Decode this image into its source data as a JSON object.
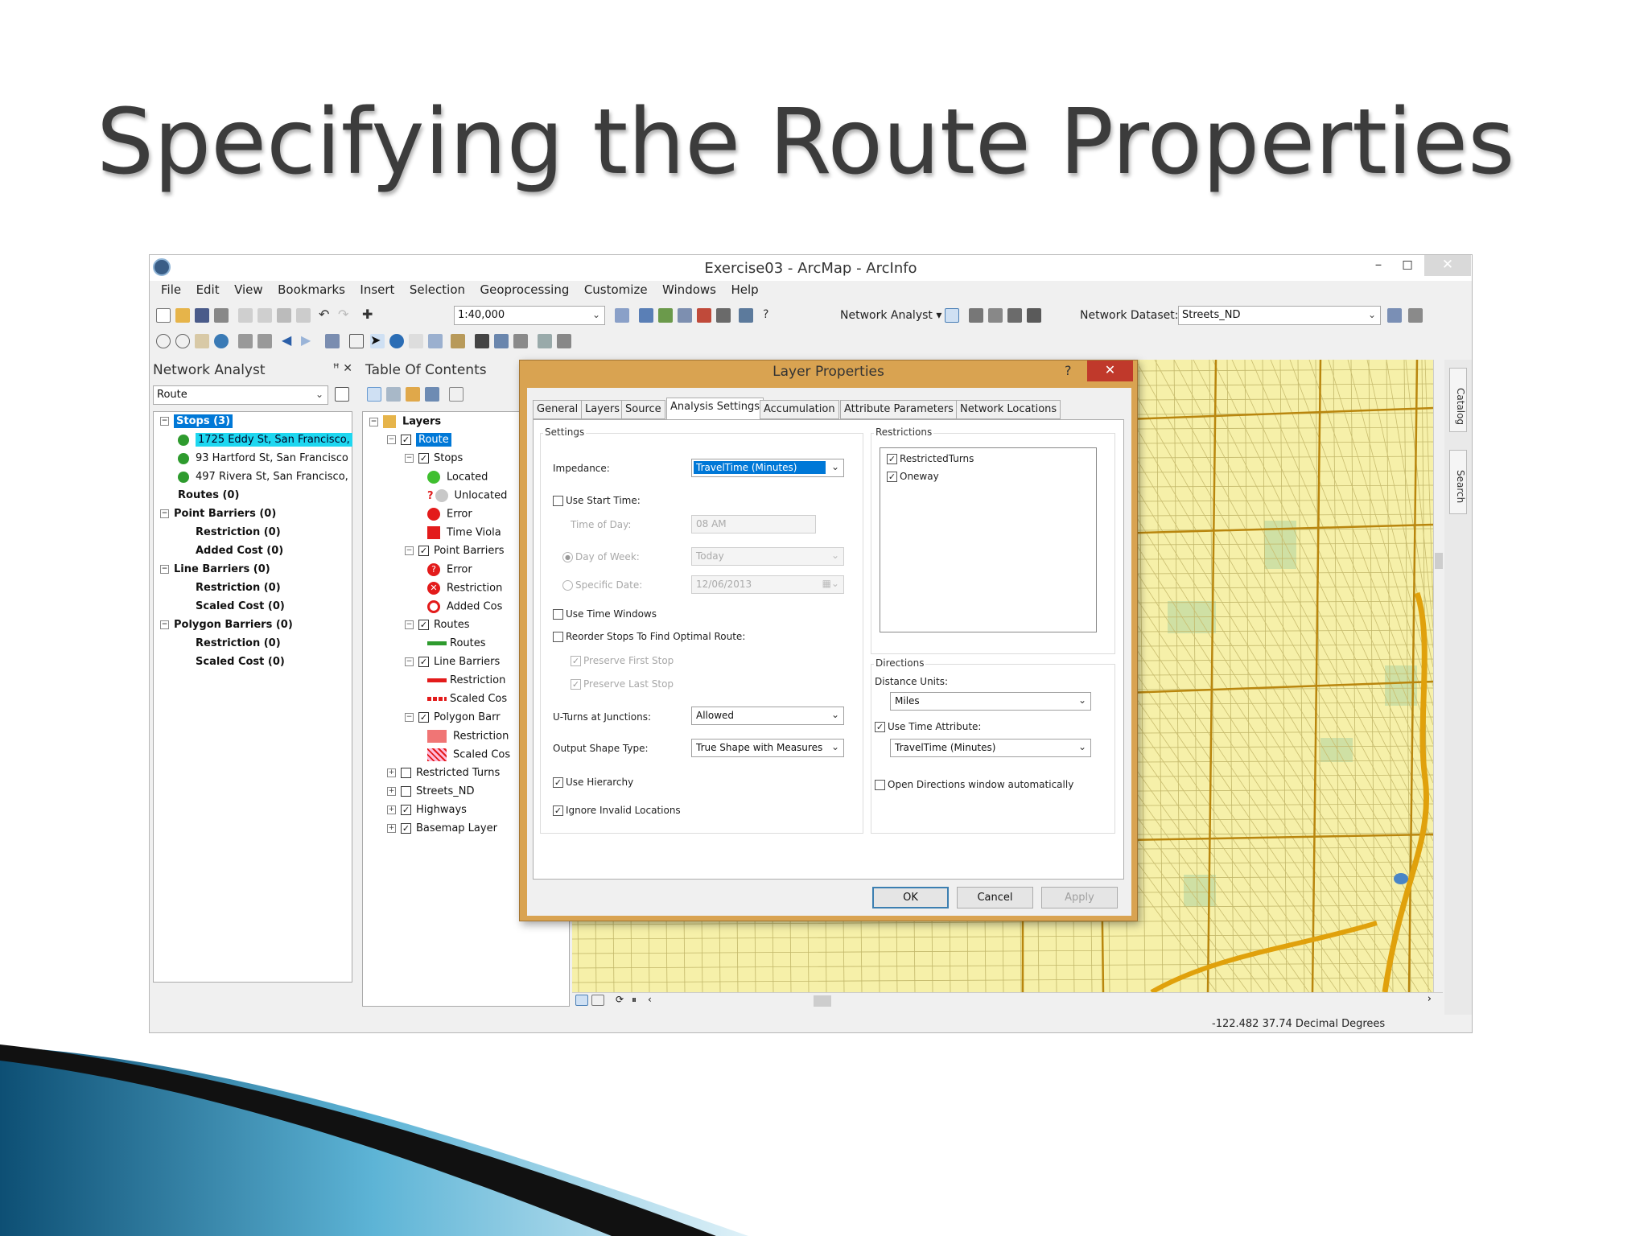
{
  "slide": {
    "title": "Specifying the Route Properties"
  },
  "window": {
    "title": "Exercise03 - ArcMap - ArcInfo",
    "minimize": "–",
    "restore": "◻",
    "close": "✕"
  },
  "menu": [
    "File",
    "Edit",
    "View",
    "Bookmarks",
    "Insert",
    "Selection",
    "Geoprocessing",
    "Customize",
    "Windows",
    "Help"
  ],
  "toolbar": {
    "scale": "1:40,000",
    "network_analyst": "Network Analyst ▾",
    "network_dataset_label": "Network Dataset:",
    "network_dataset_value": "Streets_ND"
  },
  "na_window": {
    "title": "Network Analyst",
    "pin": "ꟸ ✕",
    "analysis_layer": "Route",
    "tree": [
      {
        "label": "Stops (3)",
        "indent": 0,
        "expander": "−",
        "selected": true
      },
      {
        "label": "1725 Eddy St, San Francisco,",
        "indent": 1,
        "icon": "stop-1",
        "selected": true
      },
      {
        "label": "93 Hartford St, San Francisco",
        "indent": 1,
        "icon": "stop-2"
      },
      {
        "label": "497 Rivera St, San Francisco,",
        "indent": 1,
        "icon": "stop-3"
      },
      {
        "label": "Routes (0)",
        "indent": 1
      },
      {
        "label": "Point Barriers (0)",
        "indent": 0,
        "expander": "−"
      },
      {
        "label": "Restriction (0)",
        "indent": 2
      },
      {
        "label": "Added Cost (0)",
        "indent": 2
      },
      {
        "label": "Line Barriers (0)",
        "indent": 0,
        "expander": "−"
      },
      {
        "label": "Restriction (0)",
        "indent": 2
      },
      {
        "label": "Scaled Cost (0)",
        "indent": 2
      },
      {
        "label": "Polygon Barriers (0)",
        "indent": 0,
        "expander": "−"
      },
      {
        "label": "Restriction (0)",
        "indent": 2
      },
      {
        "label": "Scaled Cost (0)",
        "indent": 2
      }
    ]
  },
  "toc": {
    "title": "Table Of Contents",
    "rows": [
      {
        "label": "Layers",
        "level": 0,
        "expander": "−",
        "kind": "folder"
      },
      {
        "label": "Route",
        "level": 1,
        "expander": "−",
        "checked": true,
        "selected": true
      },
      {
        "label": "Stops",
        "level": 2,
        "expander": "−",
        "checked": true
      },
      {
        "label": "Located",
        "level": 3,
        "symbol": "green-dot"
      },
      {
        "label": "Unlocated",
        "level": 3,
        "symbol": "question-dot",
        "symbol_text": "?"
      },
      {
        "label": "Error",
        "level": 3,
        "symbol": "red-dot"
      },
      {
        "label": "Time Viola",
        "level": 3,
        "symbol": "red-square"
      },
      {
        "label": "Point Barriers",
        "level": 2,
        "expander": "−",
        "checked": true
      },
      {
        "label": "Error",
        "level": 3,
        "symbol": "error-icon"
      },
      {
        "label": "Restriction",
        "level": 3,
        "symbol": "restriction-icon"
      },
      {
        "label": "Added Cos",
        "level": 3,
        "symbol": "added-cost-icon"
      },
      {
        "label": "Routes",
        "level": 2,
        "expander": "−",
        "checked": true
      },
      {
        "label": "Routes",
        "level": 3,
        "symbol": "green-line"
      },
      {
        "label": "Line Barriers",
        "level": 2,
        "expander": "−",
        "checked": true
      },
      {
        "label": "Restriction",
        "level": 3,
        "symbol": "red-line"
      },
      {
        "label": "Scaled Cos",
        "level": 3,
        "symbol": "red-dash"
      },
      {
        "label": "Polygon Barr",
        "level": 2,
        "expander": "−",
        "checked": true
      },
      {
        "label": "Restriction",
        "level": 3,
        "symbol": "red-fill"
      },
      {
        "label": "Scaled Cos",
        "level": 3,
        "symbol": "hatch-fill"
      },
      {
        "label": "Restricted Turns",
        "level": 1,
        "expander": "+",
        "checked": false
      },
      {
        "label": "Streets_ND",
        "level": 1,
        "expander": "+",
        "checked": false
      },
      {
        "label": "Highways",
        "level": 1,
        "expander": "+",
        "checked": true
      },
      {
        "label": "Basemap Layer",
        "level": 1,
        "expander": "+",
        "checked": true
      }
    ]
  },
  "dialog": {
    "title": "Layer Properties",
    "help": "?",
    "close": "✕",
    "tabs": [
      "General",
      "Layers",
      "Source",
      "Analysis Settings",
      "Accumulation",
      "Attribute Parameters",
      "Network Locations"
    ],
    "active_tab": "Analysis Settings",
    "settings": {
      "group": "Settings",
      "impedance_label": "Impedance:",
      "impedance_value": "TravelTime (Minutes)",
      "use_start_time": "Use Start Time:",
      "time_of_day_label": "Time of Day:",
      "time_of_day_value": "08 AM",
      "day_of_week_label": "Day of Week:",
      "day_of_week_value": "Today",
      "specific_date_label": "Specific Date:",
      "specific_date_value": "12/06/2013",
      "use_time_windows": "Use Time Windows",
      "reorder_stops": "Reorder Stops To Find Optimal Route:",
      "preserve_first": "Preserve First Stop",
      "preserve_last": "Preserve Last Stop",
      "uturns_label": "U-Turns at Junctions:",
      "uturns_value": "Allowed",
      "output_shape_label": "Output Shape Type:",
      "output_shape_value": "True Shape with Measures",
      "use_hierarchy": "Use Hierarchy",
      "ignore_invalid": "Ignore Invalid Locations"
    },
    "restrictions": {
      "group": "Restrictions",
      "items": [
        "RestrictedTurns",
        "Oneway"
      ]
    },
    "directions": {
      "group": "Directions",
      "distance_units_label": "Distance Units:",
      "distance_units_value": "Miles",
      "use_time_attribute": "Use Time Attribute:",
      "time_attribute_value": "TravelTime (Minutes)",
      "open_directions": "Open Directions window automatically"
    },
    "buttons": {
      "ok": "OK",
      "cancel": "Cancel",
      "apply": "Apply"
    }
  },
  "side_tabs": {
    "catalog": "Catalog",
    "search": "Search"
  },
  "status": {
    "coords": "-122.482  37.74 Decimal Degrees"
  },
  "colors": {
    "map_bg": "#f6f0a9",
    "road": "#d4a017",
    "dialog_frame": "#d9a351",
    "selection": "#0078d7",
    "close_red": "#c0392b"
  }
}
